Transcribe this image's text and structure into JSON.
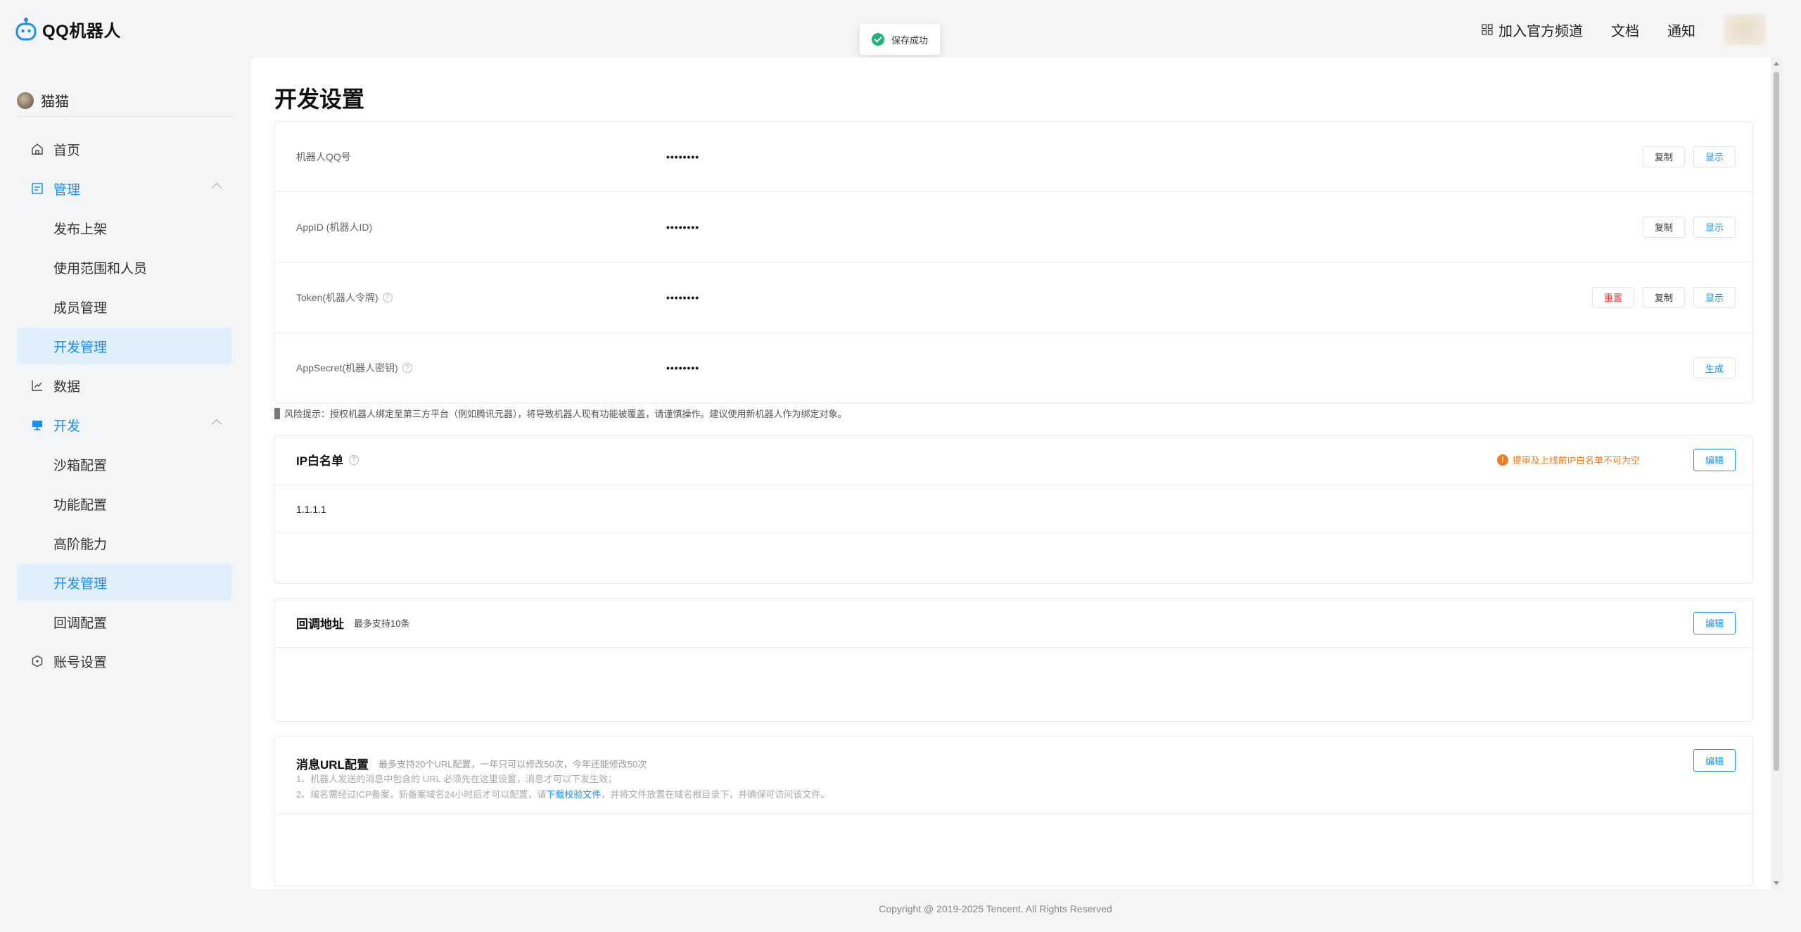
{
  "header": {
    "logo_text": "QQ机器人",
    "nav": {
      "join_channel": "加入官方频道",
      "docs": "文档",
      "notify": "通知"
    }
  },
  "toast": {
    "text": "保存成功"
  },
  "sidebar": {
    "user_name": "猫猫",
    "items": [
      {
        "label": "首页"
      },
      {
        "label": "管理"
      },
      {
        "label": "发布上架"
      },
      {
        "label": "使用范围和人员"
      },
      {
        "label": "成员管理"
      },
      {
        "label": "开发管理"
      },
      {
        "label": "数据"
      },
      {
        "label": "开发"
      },
      {
        "label": "沙箱配置"
      },
      {
        "label": "功能配置"
      },
      {
        "label": "高阶能力"
      },
      {
        "label": "开发管理"
      },
      {
        "label": "回调配置"
      },
      {
        "label": "账号设置"
      }
    ]
  },
  "main": {
    "title": "开发设置",
    "credentials": [
      {
        "label": "机器人QQ号",
        "value": "••••••••",
        "actions": [
          "复制",
          "显示"
        ]
      },
      {
        "label": "AppID (机器人ID)",
        "value": "••••••••",
        "actions": [
          "复制",
          "显示"
        ]
      },
      {
        "label": "Token(机器人令牌)",
        "value": "••••••••",
        "actions": [
          "重置",
          "复制",
          "显示"
        ]
      },
      {
        "label": "AppSecret(机器人密钥)",
        "value": "••••••••",
        "actions": [
          "生成"
        ]
      }
    ],
    "risk_note": "风险提示：授权机器人绑定至第三方平台（例如腾讯元器），将导致机器人现有功能被覆盖，请谨慎操作。建议使用新机器人作为绑定对象。",
    "ip_whitelist": {
      "title": "IP白名单",
      "warning": "提审及上线前IP白名单不可为空",
      "edit_label": "编辑",
      "ips": [
        "1.1.1.1"
      ]
    },
    "callback": {
      "title": "回调地址",
      "sub": "最多支持10条",
      "edit_label": "编辑"
    },
    "msg_url": {
      "title": "消息URL配置",
      "sub": "最多支持20个URL配置，一年只可以修改50次，今年还能修改50次",
      "line1": "1、机器人发送的消息中包含的 URL 必须先在这里设置，消息才可以下发生效；",
      "line2_pre": "2、域名需经过ICP备案，新备案域名24小时后才可以配置，请",
      "line2_link": "下载校验文件",
      "line2_post": "，并将文件放置在域名根目录下，并确保可访问该文件。",
      "edit_label": "编辑"
    }
  },
  "footer": {
    "copyright": "Copyright @ 2019-2025 Tencent. All Rights Reserved"
  }
}
